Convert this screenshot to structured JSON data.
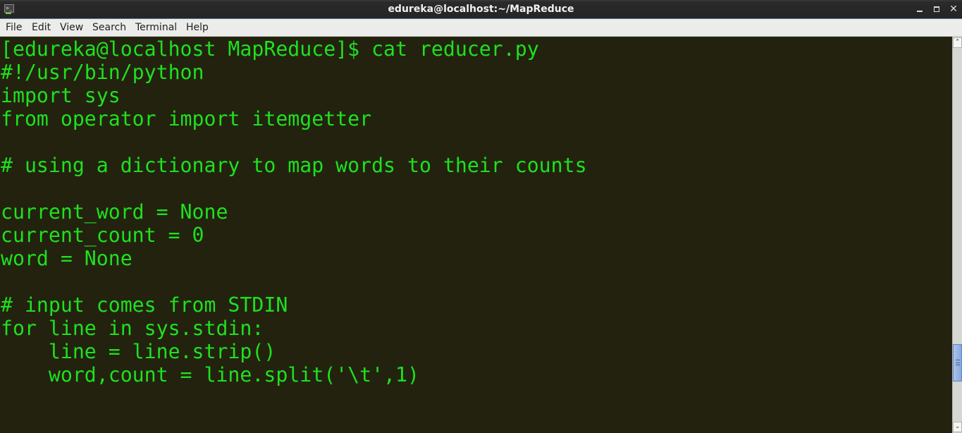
{
  "window": {
    "title": "edureka@localhost:~/MapReduce",
    "app_icon": "terminal-icon",
    "controls": {
      "minimize_icon": "minimize-icon",
      "maximize_icon": "maximize-icon",
      "close_icon": "close-icon",
      "close_glyph": "✕"
    }
  },
  "menubar": {
    "items": [
      {
        "label": "File"
      },
      {
        "label": "Edit"
      },
      {
        "label": "View"
      },
      {
        "label": "Search"
      },
      {
        "label": "Terminal"
      },
      {
        "label": "Help"
      }
    ]
  },
  "terminal": {
    "foreground_color": "#1ee11e",
    "background_color": "#23220f",
    "lines": [
      "[edureka@localhost MapReduce]$ cat reducer.py",
      "#!/usr/bin/python",
      "import sys",
      "from operator import itemgetter",
      "",
      "# using a dictionary to map words to their counts",
      "",
      "current_word = None",
      "current_count = 0",
      "word = None",
      "",
      "# input comes from STDIN",
      "for line in sys.stdin:",
      "    line = line.strip()",
      "    word,count = line.split('\\t',1)"
    ]
  },
  "scrollbar": {
    "up_glyph": "⌃",
    "down_glyph": "⌄",
    "position_fraction": 0.83
  }
}
